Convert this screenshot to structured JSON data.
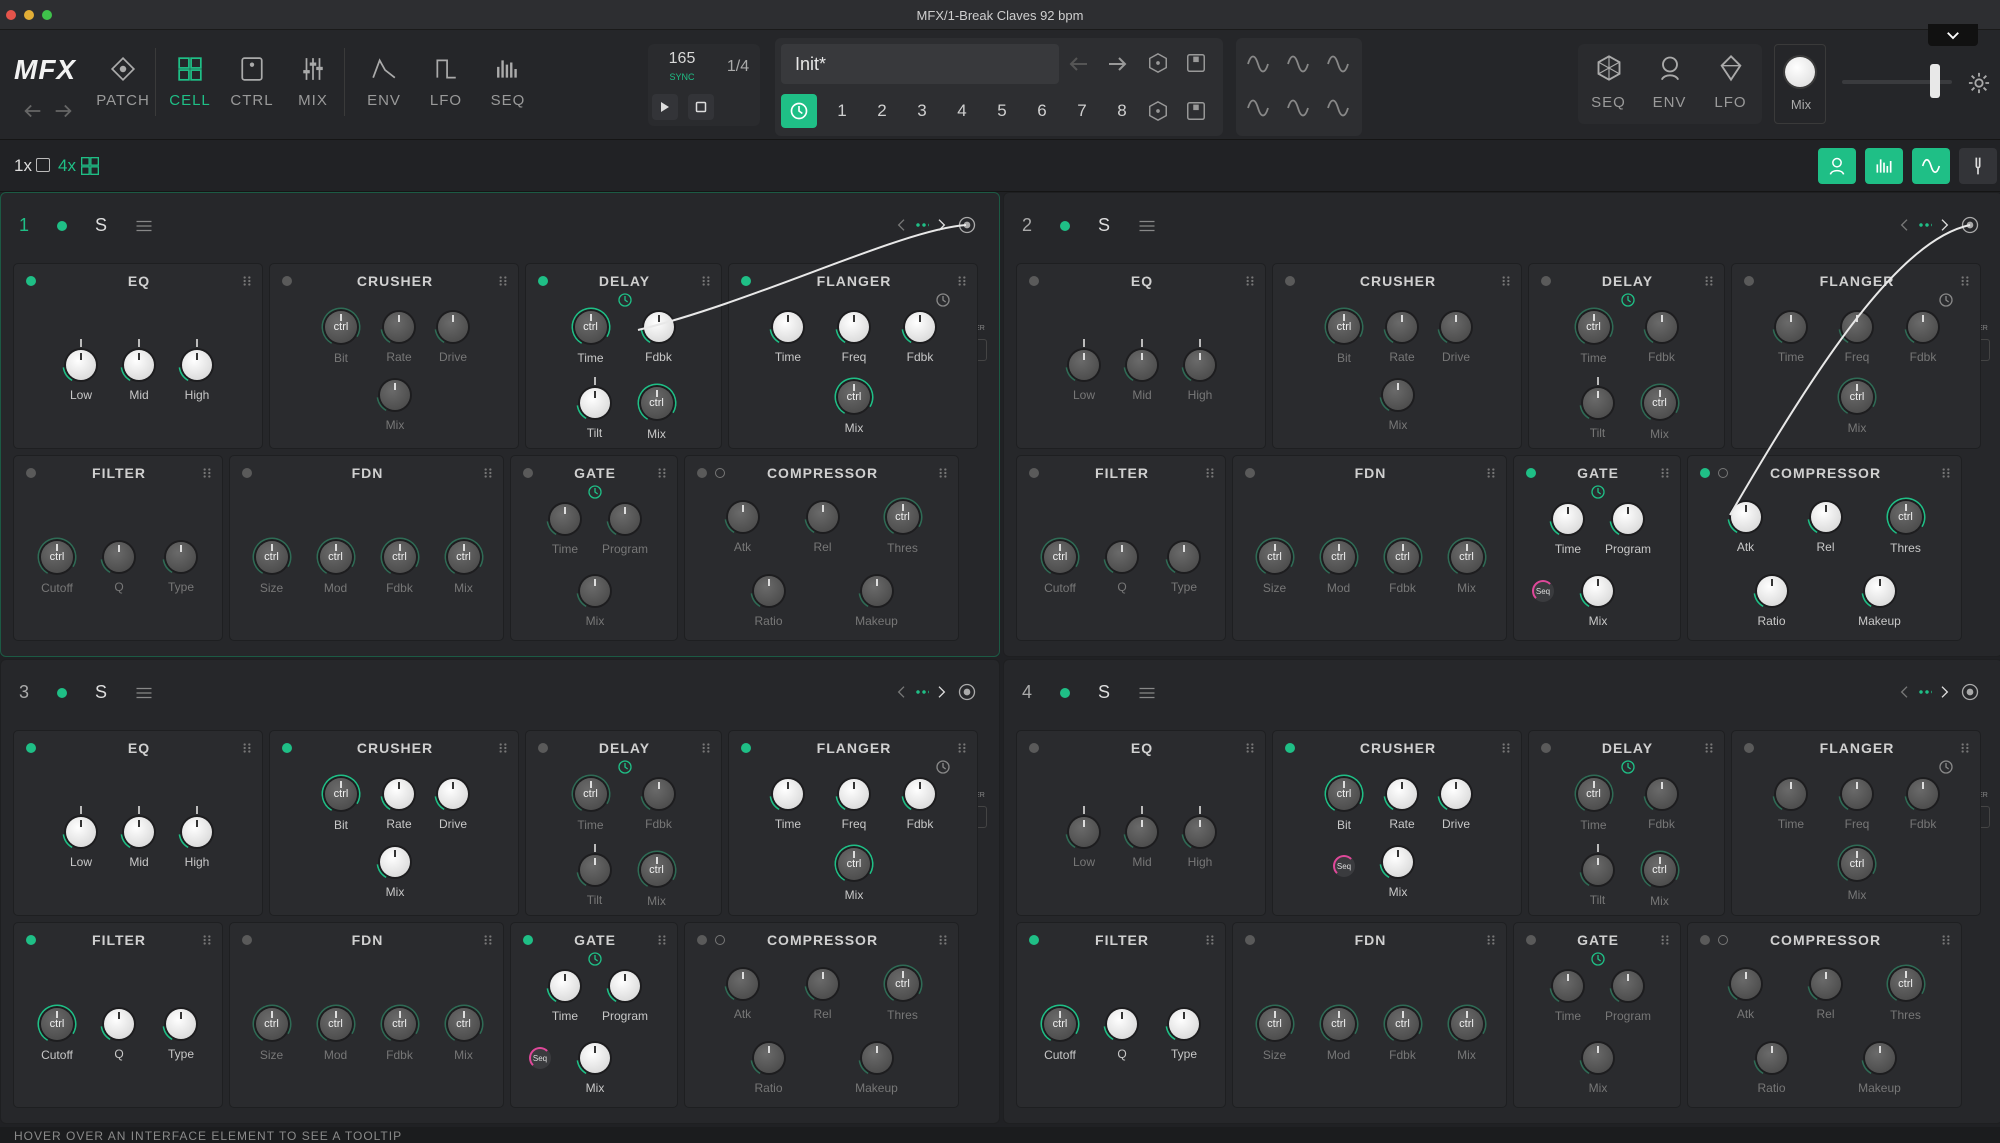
{
  "window": {
    "title": "MFX/1-Break Claves 92 bpm"
  },
  "colors": {
    "accent": "#1fbf86",
    "panel": "#2a2b2e",
    "dot_on": "#1fbf86",
    "seq": "#e0489a"
  },
  "top": {
    "logo": "MFX",
    "nav": [
      {
        "label": "PATCH",
        "icon": "patch-icon"
      },
      {
        "label": "CELL",
        "icon": "cell-grid-icon"
      },
      {
        "label": "CTRL",
        "icon": "ctrl-icon"
      },
      {
        "label": "MIX",
        "icon": "mixer-sliders-icon"
      },
      {
        "label": "ENV",
        "icon": "envelope-icon"
      },
      {
        "label": "LFO",
        "icon": "square-wave-icon"
      },
      {
        "label": "SEQ",
        "icon": "sequencer-bars-icon"
      }
    ],
    "tempo": "165",
    "sync": "SYNC",
    "division": "1/4",
    "preset": "Init*",
    "slots": [
      "1",
      "2",
      "3",
      "4",
      "5",
      "6",
      "7",
      "8"
    ],
    "mod_buttons": [
      "SEQ",
      "ENV",
      "LFO"
    ],
    "mix_label": "Mix"
  },
  "toolbar": {
    "view_1x": "1x",
    "view_4x": "4x"
  },
  "cells": [
    {
      "number": "1",
      "solo": "S",
      "active": true,
      "rows": [
        [
          {
            "title": "EQ",
            "on": true,
            "knobs": [
              {
                "l": "Low"
              },
              {
                "l": "Mid"
              },
              {
                "l": "High"
              }
            ]
          },
          {
            "title": "CRUSHER",
            "on": false,
            "knobs": [
              {
                "l": "Bit",
                "t": "ctrl"
              },
              {
                "l": "Rate"
              },
              {
                "l": "Drive"
              },
              {
                "l": "Mix"
              }
            ]
          },
          {
            "title": "DELAY",
            "on": true,
            "knobs": [
              {
                "l": "Time",
                "t": "ctrl"
              },
              {
                "l": "Fdbk"
              },
              {
                "l": "Tilt"
              },
              {
                "l": "Mix",
                "t": "ctrl"
              }
            ]
          },
          {
            "title": "FLANGER",
            "on": true,
            "knobs": [
              {
                "l": "Time"
              },
              {
                "l": "Freq"
              },
              {
                "l": "Fdbk"
              },
              {
                "l": "Mix",
                "t": "ctrl"
              }
            ]
          }
        ],
        [
          {
            "title": "FILTER",
            "on": false,
            "knobs": [
              {
                "l": "Cutoff",
                "t": "ctrl"
              },
              {
                "l": "Q"
              },
              {
                "l": "Type"
              }
            ]
          },
          {
            "title": "FDN",
            "on": false,
            "knobs": [
              {
                "l": "Size",
                "t": "ctrl"
              },
              {
                "l": "Mod",
                "t": "ctrl"
              },
              {
                "l": "Fdbk",
                "t": "ctrl"
              },
              {
                "l": "Mix",
                "t": "ctrl"
              }
            ]
          },
          {
            "title": "GATE",
            "on": false,
            "knobs": [
              {
                "l": "Time"
              },
              {
                "l": "Program"
              },
              {
                "l": "Mix"
              }
            ]
          },
          {
            "title": "COMPRESSOR",
            "on": false,
            "knobs": [
              {
                "l": "Atk"
              },
              {
                "l": "Rel"
              },
              {
                "l": "Thres",
                "t": "ctrl"
              },
              {
                "l": "Ratio"
              },
              {
                "l": "Makeup"
              }
            ]
          }
        ]
      ]
    },
    {
      "number": "2",
      "solo": "S",
      "active": false,
      "rows": [
        [
          {
            "title": "EQ",
            "on": false,
            "knobs": [
              {
                "l": "Low"
              },
              {
                "l": "Mid"
              },
              {
                "l": "High"
              }
            ]
          },
          {
            "title": "CRUSHER",
            "on": false,
            "knobs": [
              {
                "l": "Bit",
                "t": "ctrl"
              },
              {
                "l": "Rate"
              },
              {
                "l": "Drive"
              },
              {
                "l": "Mix"
              }
            ]
          },
          {
            "title": "DELAY",
            "on": false,
            "knobs": [
              {
                "l": "Time",
                "t": "ctrl"
              },
              {
                "l": "Fdbk"
              },
              {
                "l": "Tilt"
              },
              {
                "l": "Mix",
                "t": "ctrl"
              }
            ]
          },
          {
            "title": "FLANGER",
            "on": false,
            "knobs": [
              {
                "l": "Time"
              },
              {
                "l": "Freq"
              },
              {
                "l": "Fdbk"
              },
              {
                "l": "Mix",
                "t": "ctrl"
              }
            ]
          }
        ],
        [
          {
            "title": "FILTER",
            "on": false,
            "knobs": [
              {
                "l": "Cutoff",
                "t": "ctrl"
              },
              {
                "l": "Q"
              },
              {
                "l": "Type"
              }
            ]
          },
          {
            "title": "FDN",
            "on": false,
            "knobs": [
              {
                "l": "Size",
                "t": "ctrl"
              },
              {
                "l": "Mod",
                "t": "ctrl"
              },
              {
                "l": "Fdbk",
                "t": "ctrl"
              },
              {
                "l": "Mix",
                "t": "ctrl"
              }
            ]
          },
          {
            "title": "GATE",
            "on": true,
            "seq": true,
            "knobs": [
              {
                "l": "Time"
              },
              {
                "l": "Program"
              },
              {
                "l": "Mix"
              }
            ]
          },
          {
            "title": "COMPRESSOR",
            "on": true,
            "knobs": [
              {
                "l": "Atk"
              },
              {
                "l": "Rel"
              },
              {
                "l": "Thres",
                "t": "ctrl"
              },
              {
                "l": "Ratio"
              },
              {
                "l": "Makeup"
              }
            ]
          }
        ]
      ]
    },
    {
      "number": "3",
      "solo": "S",
      "active": false,
      "rows": [
        [
          {
            "title": "EQ",
            "on": true,
            "knobs": [
              {
                "l": "Low"
              },
              {
                "l": "Mid"
              },
              {
                "l": "High"
              }
            ]
          },
          {
            "title": "CRUSHER",
            "on": true,
            "knobs": [
              {
                "l": "Bit",
                "t": "ctrl"
              },
              {
                "l": "Rate"
              },
              {
                "l": "Drive"
              },
              {
                "l": "Mix"
              }
            ]
          },
          {
            "title": "DELAY",
            "on": false,
            "knobs": [
              {
                "l": "Time",
                "t": "ctrl"
              },
              {
                "l": "Fdbk"
              },
              {
                "l": "Tilt"
              },
              {
                "l": "Mix",
                "t": "ctrl"
              }
            ]
          },
          {
            "title": "FLANGER",
            "on": true,
            "knobs": [
              {
                "l": "Time"
              },
              {
                "l": "Freq"
              },
              {
                "l": "Fdbk"
              },
              {
                "l": "Mix",
                "t": "ctrl"
              }
            ]
          }
        ],
        [
          {
            "title": "FILTER",
            "on": true,
            "knobs": [
              {
                "l": "Cutoff",
                "t": "ctrl"
              },
              {
                "l": "Q"
              },
              {
                "l": "Type"
              }
            ]
          },
          {
            "title": "FDN",
            "on": false,
            "knobs": [
              {
                "l": "Size",
                "t": "ctrl"
              },
              {
                "l": "Mod",
                "t": "ctrl"
              },
              {
                "l": "Fdbk",
                "t": "ctrl"
              },
              {
                "l": "Mix",
                "t": "ctrl"
              }
            ]
          },
          {
            "title": "GATE",
            "on": true,
            "seq": true,
            "knobs": [
              {
                "l": "Time"
              },
              {
                "l": "Program"
              },
              {
                "l": "Mix"
              }
            ]
          },
          {
            "title": "COMPRESSOR",
            "on": false,
            "knobs": [
              {
                "l": "Atk"
              },
              {
                "l": "Rel"
              },
              {
                "l": "Thres",
                "t": "ctrl"
              },
              {
                "l": "Ratio"
              },
              {
                "l": "Makeup"
              }
            ]
          }
        ]
      ]
    },
    {
      "number": "4",
      "solo": "S",
      "active": false,
      "rows": [
        [
          {
            "title": "EQ",
            "on": false,
            "knobs": [
              {
                "l": "Low"
              },
              {
                "l": "Mid"
              },
              {
                "l": "High"
              }
            ]
          },
          {
            "title": "CRUSHER",
            "on": true,
            "seq": true,
            "knobs": [
              {
                "l": "Bit",
                "t": "ctrl"
              },
              {
                "l": "Rate"
              },
              {
                "l": "Drive"
              },
              {
                "l": "Mix"
              }
            ]
          },
          {
            "title": "DELAY",
            "on": false,
            "knobs": [
              {
                "l": "Time",
                "t": "ctrl"
              },
              {
                "l": "Fdbk"
              },
              {
                "l": "Tilt"
              },
              {
                "l": "Mix",
                "t": "ctrl"
              }
            ]
          },
          {
            "title": "FLANGER",
            "on": false,
            "knobs": [
              {
                "l": "Time"
              },
              {
                "l": "Freq"
              },
              {
                "l": "Fdbk"
              },
              {
                "l": "Mix",
                "t": "ctrl"
              }
            ]
          }
        ],
        [
          {
            "title": "FILTER",
            "on": true,
            "knobs": [
              {
                "l": "Cutoff",
                "t": "ctrl"
              },
              {
                "l": "Q"
              },
              {
                "l": "Type"
              }
            ]
          },
          {
            "title": "FDN",
            "on": false,
            "knobs": [
              {
                "l": "Size",
                "t": "ctrl"
              },
              {
                "l": "Mod",
                "t": "ctrl"
              },
              {
                "l": "Fdbk",
                "t": "ctrl"
              },
              {
                "l": "Mix",
                "t": "ctrl"
              }
            ]
          },
          {
            "title": "GATE",
            "on": false,
            "knobs": [
              {
                "l": "Time"
              },
              {
                "l": "Program"
              },
              {
                "l": "Mix"
              }
            ]
          },
          {
            "title": "COMPRESSOR",
            "on": false,
            "knobs": [
              {
                "l": "Atk"
              },
              {
                "l": "Rel"
              },
              {
                "l": "Thres",
                "t": "ctrl"
              },
              {
                "l": "Ratio"
              },
              {
                "l": "Makeup"
              }
            ]
          }
        ]
      ]
    }
  ],
  "side": {
    "limiter": "LIMITER",
    "fx": "FX"
  },
  "knob_text": "ctrl",
  "seq_badge": "Seq",
  "status": "HOVER OVER AN INTERFACE ELEMENT TO SEE A TOOLTIP"
}
